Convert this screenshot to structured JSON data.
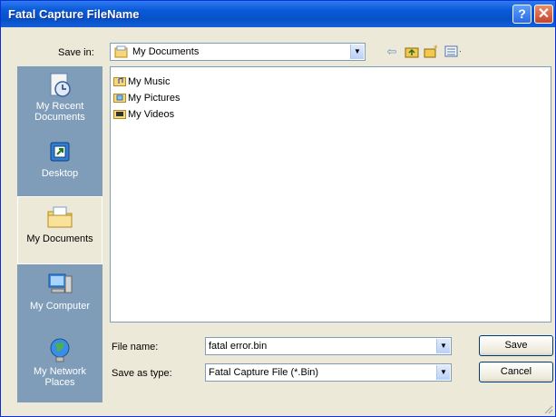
{
  "window": {
    "title": "Fatal Capture FileName",
    "help_glyph": "?",
    "close_glyph": "✕"
  },
  "save_in": {
    "label": "Save in:",
    "value": "My Documents"
  },
  "toolbar": {
    "back_icon": "back-arrow-icon",
    "up_icon": "up-folder-icon",
    "new_folder_icon": "new-folder-icon",
    "views_icon": "views-menu-icon"
  },
  "places": [
    {
      "label": "My Recent Documents",
      "icon": "recent-documents-icon"
    },
    {
      "label": "Desktop",
      "icon": "desktop-icon"
    },
    {
      "label": "My Documents",
      "icon": "my-documents-icon",
      "selected": true
    },
    {
      "label": "My Computer",
      "icon": "my-computer-icon"
    },
    {
      "label": "My Network Places",
      "icon": "network-places-icon"
    }
  ],
  "files": [
    {
      "name": "My Music",
      "icon": "music-folder-icon"
    },
    {
      "name": "My Pictures",
      "icon": "pictures-folder-icon"
    },
    {
      "name": "My Videos",
      "icon": "videos-folder-icon"
    }
  ],
  "file_name": {
    "label": "File name:",
    "value": "fatal error.bin"
  },
  "save_as_type": {
    "label": "Save as type:",
    "value": "Fatal Capture File (*.Bin)"
  },
  "buttons": {
    "save": "Save",
    "cancel": "Cancel"
  },
  "colors": {
    "title_bar": "#0a5ad8",
    "places_bar": "#7f9db9",
    "dialog_bg": "#ece9d8"
  }
}
